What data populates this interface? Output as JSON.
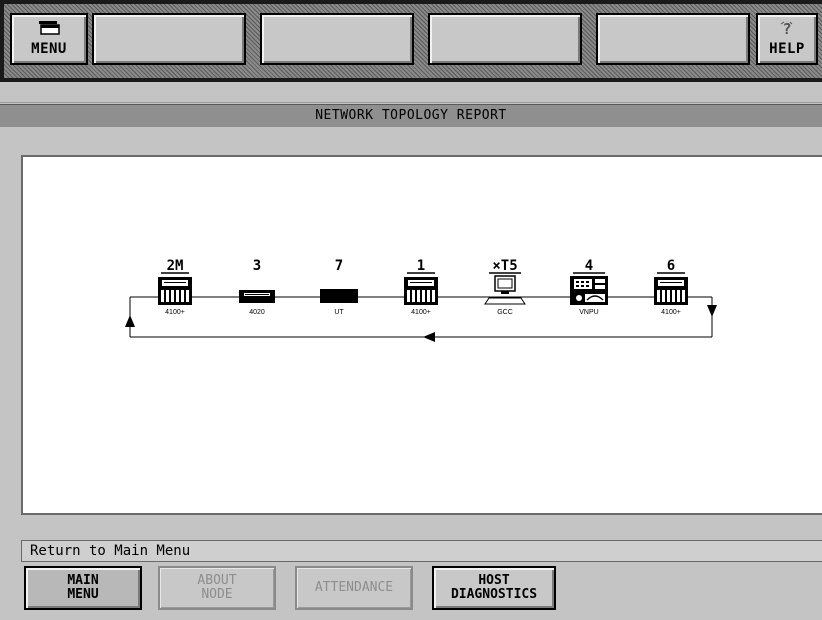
{
  "toolbar": {
    "menu_label": "MENU",
    "help_label": "HELP",
    "menu_icon": "menu-icon",
    "help_icon": "help-icon"
  },
  "report": {
    "title": "NETWORK TOPOLOGY REPORT"
  },
  "nodes": [
    {
      "id": "2M",
      "type": "4100+"
    },
    {
      "id": "3",
      "type": "4020"
    },
    {
      "id": "7",
      "type": "UT"
    },
    {
      "id": "1",
      "type": "4100+"
    },
    {
      "id": "×T5",
      "type": "GCC"
    },
    {
      "id": "4",
      "type": "VNPU"
    },
    {
      "id": "6",
      "type": "4100+"
    }
  ],
  "status": {
    "text": "Return to Main Menu"
  },
  "bottom_buttons": {
    "main_menu": "MAIN\nMENU",
    "about_node": "ABOUT\nNODE",
    "attendance": "ATTENDANCE",
    "host_diagnostics": "HOST\nDIAGNOSTICS"
  },
  "colors": {
    "background": "#c4c4c4",
    "canvas": "#ffffff",
    "title_bar": "#8f8f8f",
    "disabled_text": "#8e8e8e"
  }
}
